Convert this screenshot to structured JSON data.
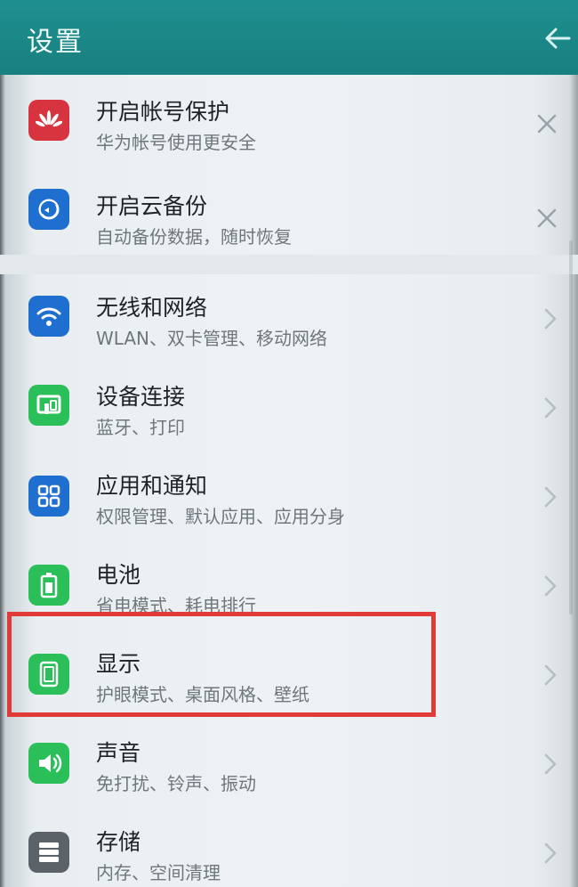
{
  "header": {
    "title": "设置"
  },
  "promos": [
    {
      "title": "开启帐号保护",
      "subtitle": "华为帐号使用更安全",
      "icon": "huawei-logo-icon",
      "color": "#d8343f"
    },
    {
      "title": "开启云备份",
      "subtitle": "自动备份数据，随时恢复",
      "icon": "cloud-backup-icon",
      "color": "#1f6fd1"
    }
  ],
  "settings": [
    {
      "title": "无线和网络",
      "subtitle": "WLAN、双卡管理、移动网络",
      "icon": "wifi-icon",
      "color": "#1f6fd1"
    },
    {
      "title": "设备连接",
      "subtitle": "蓝牙、打印",
      "icon": "device-connect-icon",
      "color": "#2bbf5a"
    },
    {
      "title": "应用和通知",
      "subtitle": "权限管理、默认应用、应用分身",
      "icon": "apps-grid-icon",
      "color": "#1f6fd1"
    },
    {
      "title": "电池",
      "subtitle": "省电模式、耗电排行",
      "icon": "battery-icon",
      "color": "#2bbf5a"
    },
    {
      "title": "显示",
      "subtitle": "护眼模式、桌面风格、壁纸",
      "icon": "display-icon",
      "color": "#2bbf5a"
    },
    {
      "title": "声音",
      "subtitle": "免打扰、铃声、振动",
      "icon": "speaker-icon",
      "color": "#2bbf5a"
    },
    {
      "title": "存储",
      "subtitle": "内存、空间清理",
      "icon": "storage-icon",
      "color": "#5c6368"
    }
  ],
  "colors": {
    "header": "#1a8585",
    "highlight": "#e23a36"
  }
}
